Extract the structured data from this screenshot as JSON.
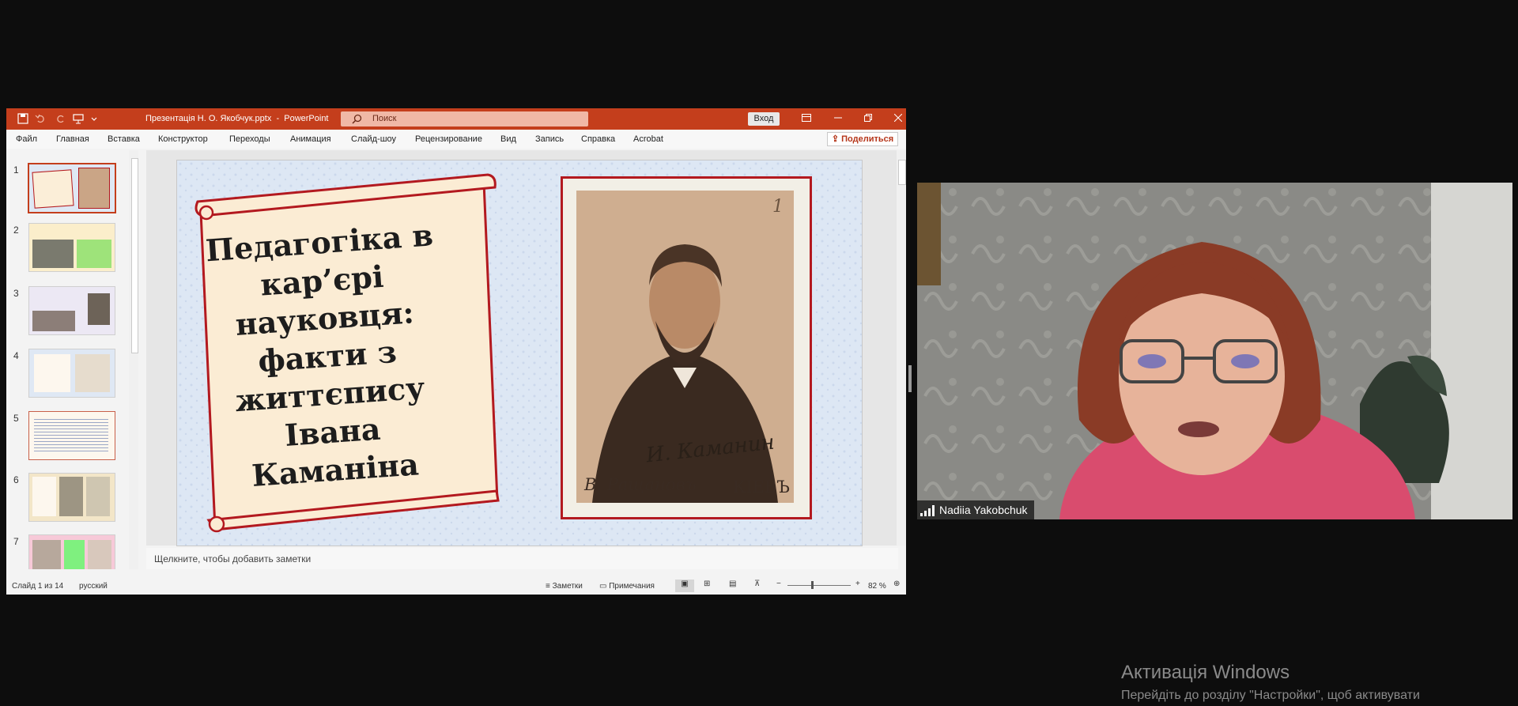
{
  "powerpoint": {
    "window_title": "Презентація Н. О. Якобчук.pptx  -  PowerPoint",
    "search_placeholder": "Поиск",
    "sign_in_label": "Вход",
    "share_label": "Поделиться",
    "accent_color": "#c43e1c",
    "menu": [
      "Файл",
      "Главная",
      "Вставка",
      "Конструктор",
      "Переходы",
      "Анимация",
      "Слайд-шоу",
      "Рецензирование",
      "Вид",
      "Запись",
      "Справка",
      "Acrobat"
    ],
    "thumbnails": [
      "1",
      "2",
      "3",
      "4",
      "5",
      "6",
      "7"
    ],
    "selected_slide": "1",
    "slide": {
      "title_lines": [
        "Педагогіка в",
        "кар’єрі",
        "науковця:",
        "факти з",
        "життєпису",
        "Івана Каманіна"
      ],
      "photo_number": "1",
      "photo_signature": "И. Каманин",
      "photo_studio": "В. Ращановъ",
      "photo_city": "КIЕВЪ"
    },
    "notes_placeholder": "Щелкните, чтобы добавить заметки",
    "status": {
      "slide_counter": "Слайд 1 из 14",
      "language": "русский",
      "notes_label": "Заметки",
      "comments_label": "Примечания",
      "zoom": "82 %"
    }
  },
  "webcam": {
    "participant_name": "Nadiia Yakobchuk"
  },
  "windows_activation": {
    "title": "Активація Windows",
    "subtitle": "Перейдіть до розділу \"Настройки\", щоб активувати"
  }
}
